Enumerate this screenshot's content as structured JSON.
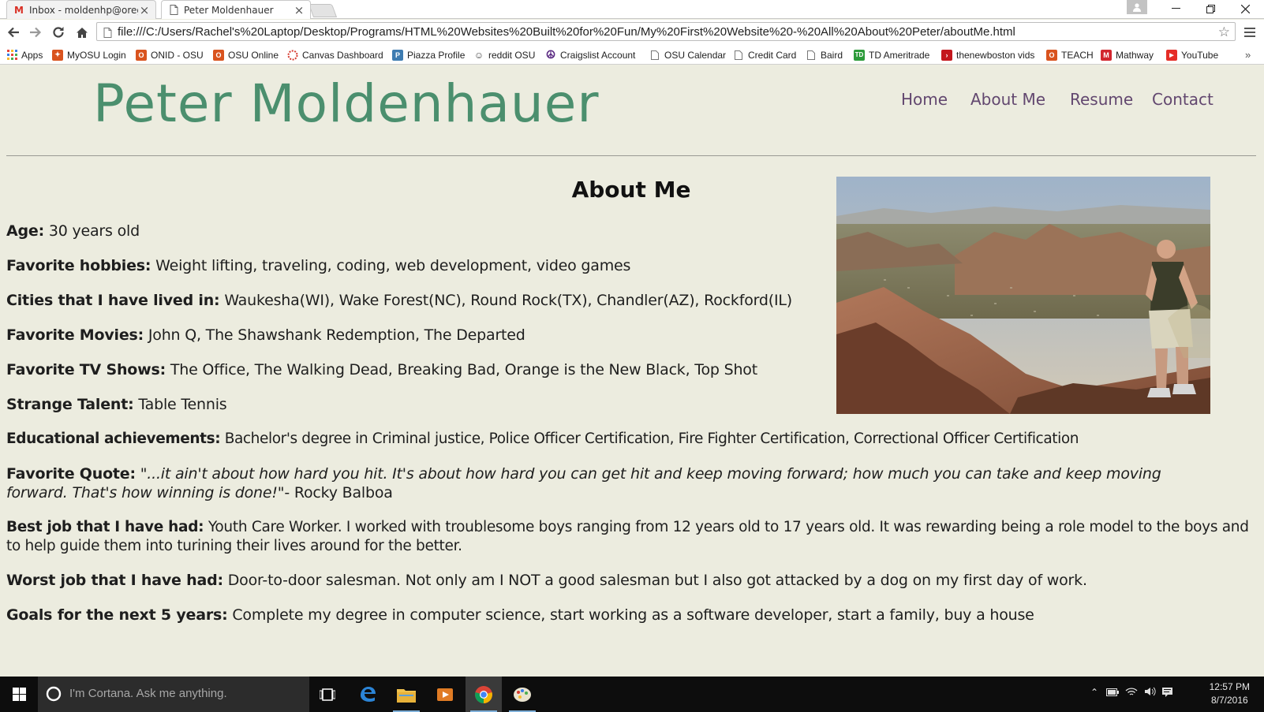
{
  "browser": {
    "tabs": [
      {
        "title": "Inbox - moldenhp@oregc",
        "icon": "gmail-icon",
        "active": false
      },
      {
        "title": "Peter Moldenhauer",
        "icon": "page-icon",
        "active": true
      }
    ],
    "url": "file:///C:/Users/Rachel's%20Laptop/Desktop/Programs/HTML%20Websites%20Built%20for%20Fun/My%20First%20Website%20-%20All%20About%20Peter/aboutMe.html",
    "bookmarks": [
      {
        "label": "Apps",
        "icon": "apps-icon"
      },
      {
        "label": "MyOSU Login",
        "icon": "osu-icon"
      },
      {
        "label": "ONID - OSU",
        "icon": "osu-icon"
      },
      {
        "label": "OSU Online",
        "icon": "osu-icon"
      },
      {
        "label": "Canvas Dashboard",
        "icon": "canvas-icon"
      },
      {
        "label": "Piazza Profile",
        "icon": "piazza-icon"
      },
      {
        "label": "reddit OSU",
        "icon": "reddit-icon"
      },
      {
        "label": "Craigslist Account",
        "icon": "peace-icon"
      },
      {
        "label": "OSU Calendar",
        "icon": "page-icon"
      },
      {
        "label": "Credit Card",
        "icon": "page-icon"
      },
      {
        "label": "Baird",
        "icon": "page-icon"
      },
      {
        "label": "TD Ameritrade",
        "icon": "td-icon"
      },
      {
        "label": "thenewboston vids",
        "icon": "newboston-icon"
      },
      {
        "label": "TEACH",
        "icon": "osu-icon"
      },
      {
        "label": "Mathway",
        "icon": "mathway-icon"
      },
      {
        "label": "YouTube",
        "icon": "youtube-icon"
      }
    ]
  },
  "site": {
    "title": "Peter Moldenhauer",
    "nav": [
      "Home",
      "About Me",
      "Resume",
      "Contact"
    ],
    "heading": "About Me",
    "fields": [
      {
        "label": "Age:",
        "value": "30 years old"
      },
      {
        "label": "Favorite hobbies:",
        "value": "Weight lifting, traveling, coding, web development, video games"
      },
      {
        "label": "Cities that I have lived in:",
        "value": "Waukesha(WI), Wake Forest(NC), Round Rock(TX), Chandler(AZ), Rockford(IL)"
      },
      {
        "label": "Favorite Movies:",
        "value": "John Q, The Shawshank Redemption, The Departed"
      },
      {
        "label": "Favorite TV Shows:",
        "value": "The Office, The Walking Dead, Breaking Bad, Orange is the New Black, Top Shot"
      },
      {
        "label": "Strange Talent:",
        "value": "Table Tennis"
      },
      {
        "label": "Educational achievements:",
        "value": "Bachelor's degree in Criminal justice, Police Officer Certification, Fire Fighter Certification, Correctional Officer Certification"
      }
    ],
    "quote": {
      "label": "Favorite Quote:",
      "text": "\"...it ain't about how hard you hit. It's about how hard you can get hit and keep moving forward; how much you can take and keep moving forward. That's how winning is done!\"",
      "author": "- Rocky Balboa"
    },
    "fields2": [
      {
        "label": "Best job that I have had:",
        "value": "Youth Care Worker. I worked with troublesome boys ranging from 12 years old to 17 years old. It was rewarding being a role model to the boys and to help guide them into turining their lives around for the better."
      },
      {
        "label": "Worst job that I have had:",
        "value": "Door-to-door salesman. Not only am I NOT a good salesman but I also got attacked by a dog on my first day of work."
      },
      {
        "label": "Goals for the next 5 years:",
        "value": "Complete my degree in computer science, start working as a software developer, start a family, buy a house"
      }
    ],
    "colors": {
      "title": "#4b8f6e",
      "nav": "#62476f",
      "background": "#ececdf"
    }
  },
  "taskbar": {
    "search_placeholder": "I'm Cortana. Ask me anything.",
    "time": "12:57 PM",
    "date": "8/7/2016",
    "apps": [
      "task-view-icon",
      "edge-icon",
      "file-explorer-icon",
      "media-player-icon",
      "chrome-icon",
      "paint-icon"
    ]
  }
}
